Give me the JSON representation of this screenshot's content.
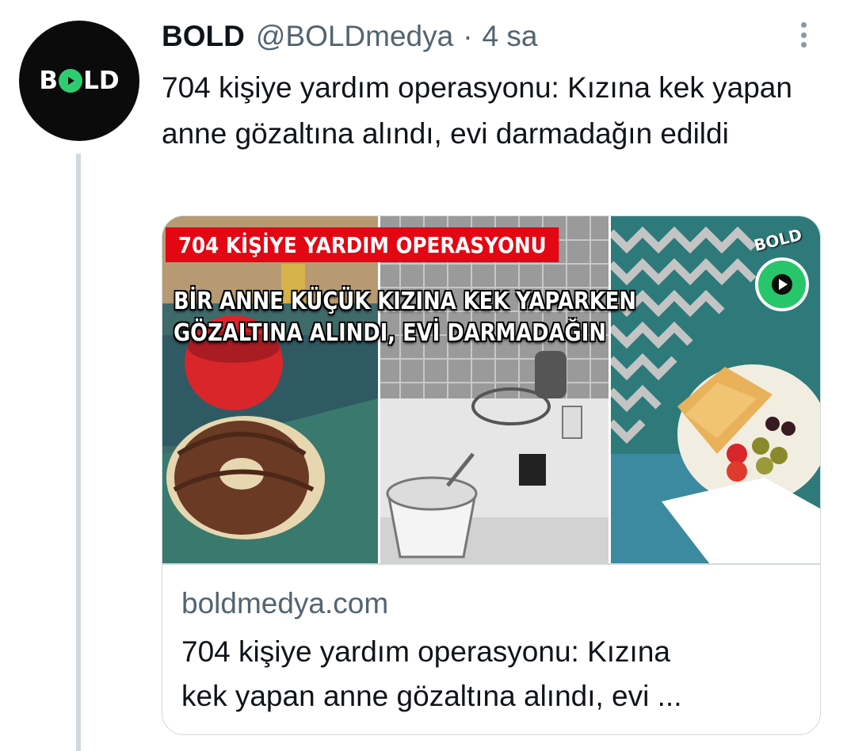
{
  "account": {
    "display_name": "BOLD",
    "handle": "@BOLDmedya",
    "separator": "·",
    "time": "4 sa",
    "avatar_text_b": "B",
    "avatar_text_ld": "LD"
  },
  "tweet": {
    "text": "704 kişiye yardım operasyonu: Kızına kek yapan anne gözaltına alındı, evi darmadağın edildi"
  },
  "card": {
    "banner": "704 KİŞİYE YARDIM OPERASYONU",
    "headline_line1": "BİR ANNE KÜÇÜK KIZINA KEK YAPARKEN",
    "headline_line2": "GÖZALTINA ALINDI, EVİ DARMADAĞIN",
    "logo_word": "BOLD",
    "domain": "boldmedya.com",
    "title_line1": "704 kişiye yardım operasyonu: Kızına",
    "title_line2": "kek yapan anne gözaltına alındı, evi ..."
  },
  "icons": {
    "more": "more-vertical-icon",
    "play": "play-icon"
  },
  "colors": {
    "brand_green": "#27c66b",
    "banner_red": "#e30613",
    "secondary_text": "#536471"
  }
}
